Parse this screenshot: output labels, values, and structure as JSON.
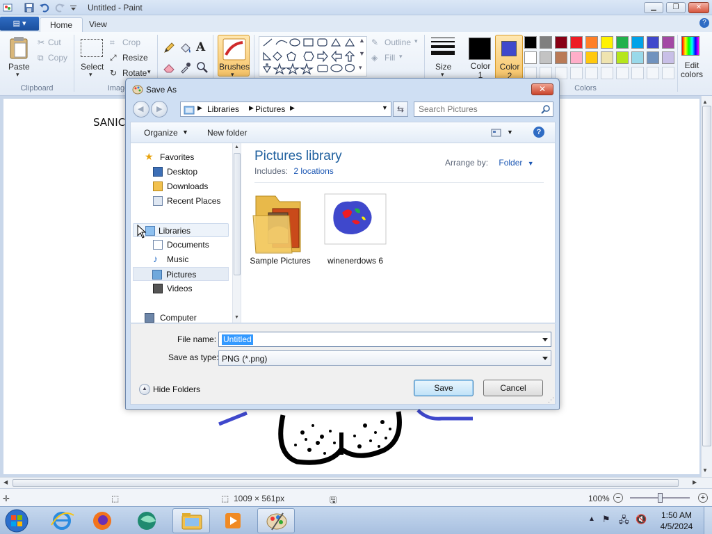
{
  "paint": {
    "title": "Untitled - Paint",
    "tabs": [
      "Home",
      "View"
    ],
    "clipboard": {
      "paste": "Paste",
      "cut": "Cut",
      "copy": "Copy",
      "group": "Clipboard"
    },
    "image": {
      "select": "Select",
      "crop": "Crop",
      "resize": "Resize",
      "rotate": "Rotate",
      "group": "Image"
    },
    "brushes": "Brushes",
    "shapes": {
      "outline": "Outline",
      "fill": "Fill"
    },
    "size": "Size",
    "color1": "Color 1",
    "color2": "Color 2",
    "colors_group": "Colors",
    "edit_colors": "Edit colors",
    "palette_row1": [
      "#000000",
      "#7f7f7f",
      "#880015",
      "#ed1c24",
      "#ff7f27",
      "#fff200",
      "#22b14c",
      "#00a2e8",
      "#3f48cc",
      "#a349a4"
    ],
    "palette_row2": [
      "#ffffff",
      "#c3c3c3",
      "#b97a57",
      "#ffaec9",
      "#ffc90e",
      "#efe4b0",
      "#b5e61d",
      "#99d9ea",
      "#7092be",
      "#c8bfe7"
    ],
    "color1_value": "#000000",
    "color2_value": "#3f48cc",
    "canvas_text": "SANIC",
    "status": {
      "dimensions": "1009 × 561px",
      "zoom": "100%"
    }
  },
  "dialog": {
    "title": "Save As",
    "breadcrumb": [
      "Libraries",
      "Pictures"
    ],
    "search_placeholder": "Search Pictures",
    "organize": "Organize",
    "new_folder": "New folder",
    "nav": {
      "favorites": "Favorites",
      "desktop": "Desktop",
      "downloads": "Downloads",
      "recent": "Recent Places",
      "libraries": "Libraries",
      "documents": "Documents",
      "music": "Music",
      "pictures": "Pictures",
      "videos": "Videos",
      "computer": "Computer"
    },
    "library_title": "Pictures library",
    "includes_label": "Includes:",
    "includes_link": "2 locations",
    "arrange_label": "Arrange by:",
    "arrange_value": "Folder",
    "files": [
      {
        "name": "Sample Pictures",
        "kind": "folder-icon"
      },
      {
        "name": "winenerdows 6",
        "kind": "image-thumbnail"
      }
    ],
    "file_name_label": "File name:",
    "file_name_value": "Untitled",
    "save_type_label": "Save as type:",
    "save_type_value": "PNG (*.png)",
    "hide_folders": "Hide Folders",
    "save": "Save",
    "cancel": "Cancel"
  },
  "taskbar": {
    "time": "1:50 AM",
    "date": "4/5/2024"
  }
}
